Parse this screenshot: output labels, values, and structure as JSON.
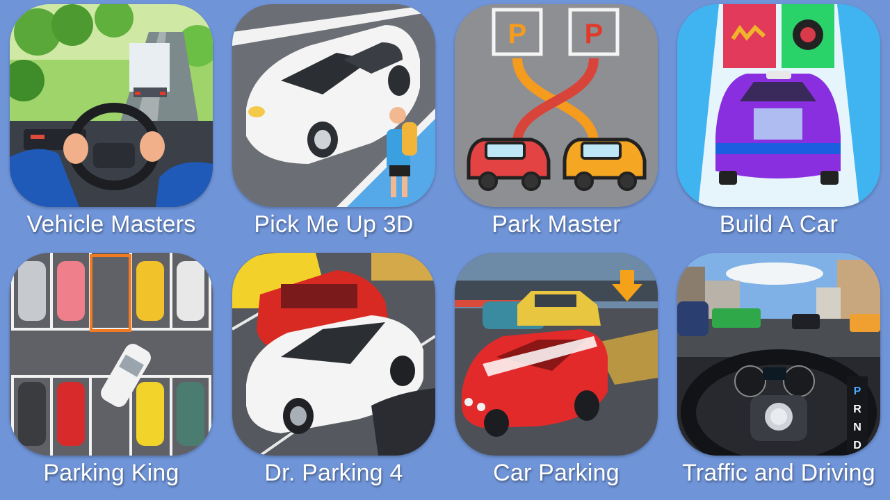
{
  "apps": [
    {
      "title": "Vehicle Masters",
      "icon": "vehicle-masters-icon"
    },
    {
      "title": "Pick Me Up 3D",
      "icon": "pick-me-up-icon"
    },
    {
      "title": "Park Master",
      "icon": "park-master-icon"
    },
    {
      "title": "Build A Car",
      "icon": "build-a-car-icon"
    },
    {
      "title": "Parking King",
      "icon": "parking-king-icon"
    },
    {
      "title": "Dr. Parking 4",
      "icon": "dr-parking-icon"
    },
    {
      "title": "Car Parking",
      "icon": "car-parking-icon"
    },
    {
      "title": "Traffic and Driving",
      "icon": "traffic-driving-icon"
    }
  ],
  "icon_text": {
    "park_sign_left": "P",
    "park_sign_right": "P",
    "gear_p": "P",
    "gear_r": "R",
    "gear_n": "N",
    "gear_d": "D"
  },
  "colors": {
    "background": "#6f94d8",
    "title_text": "#ffffff"
  }
}
